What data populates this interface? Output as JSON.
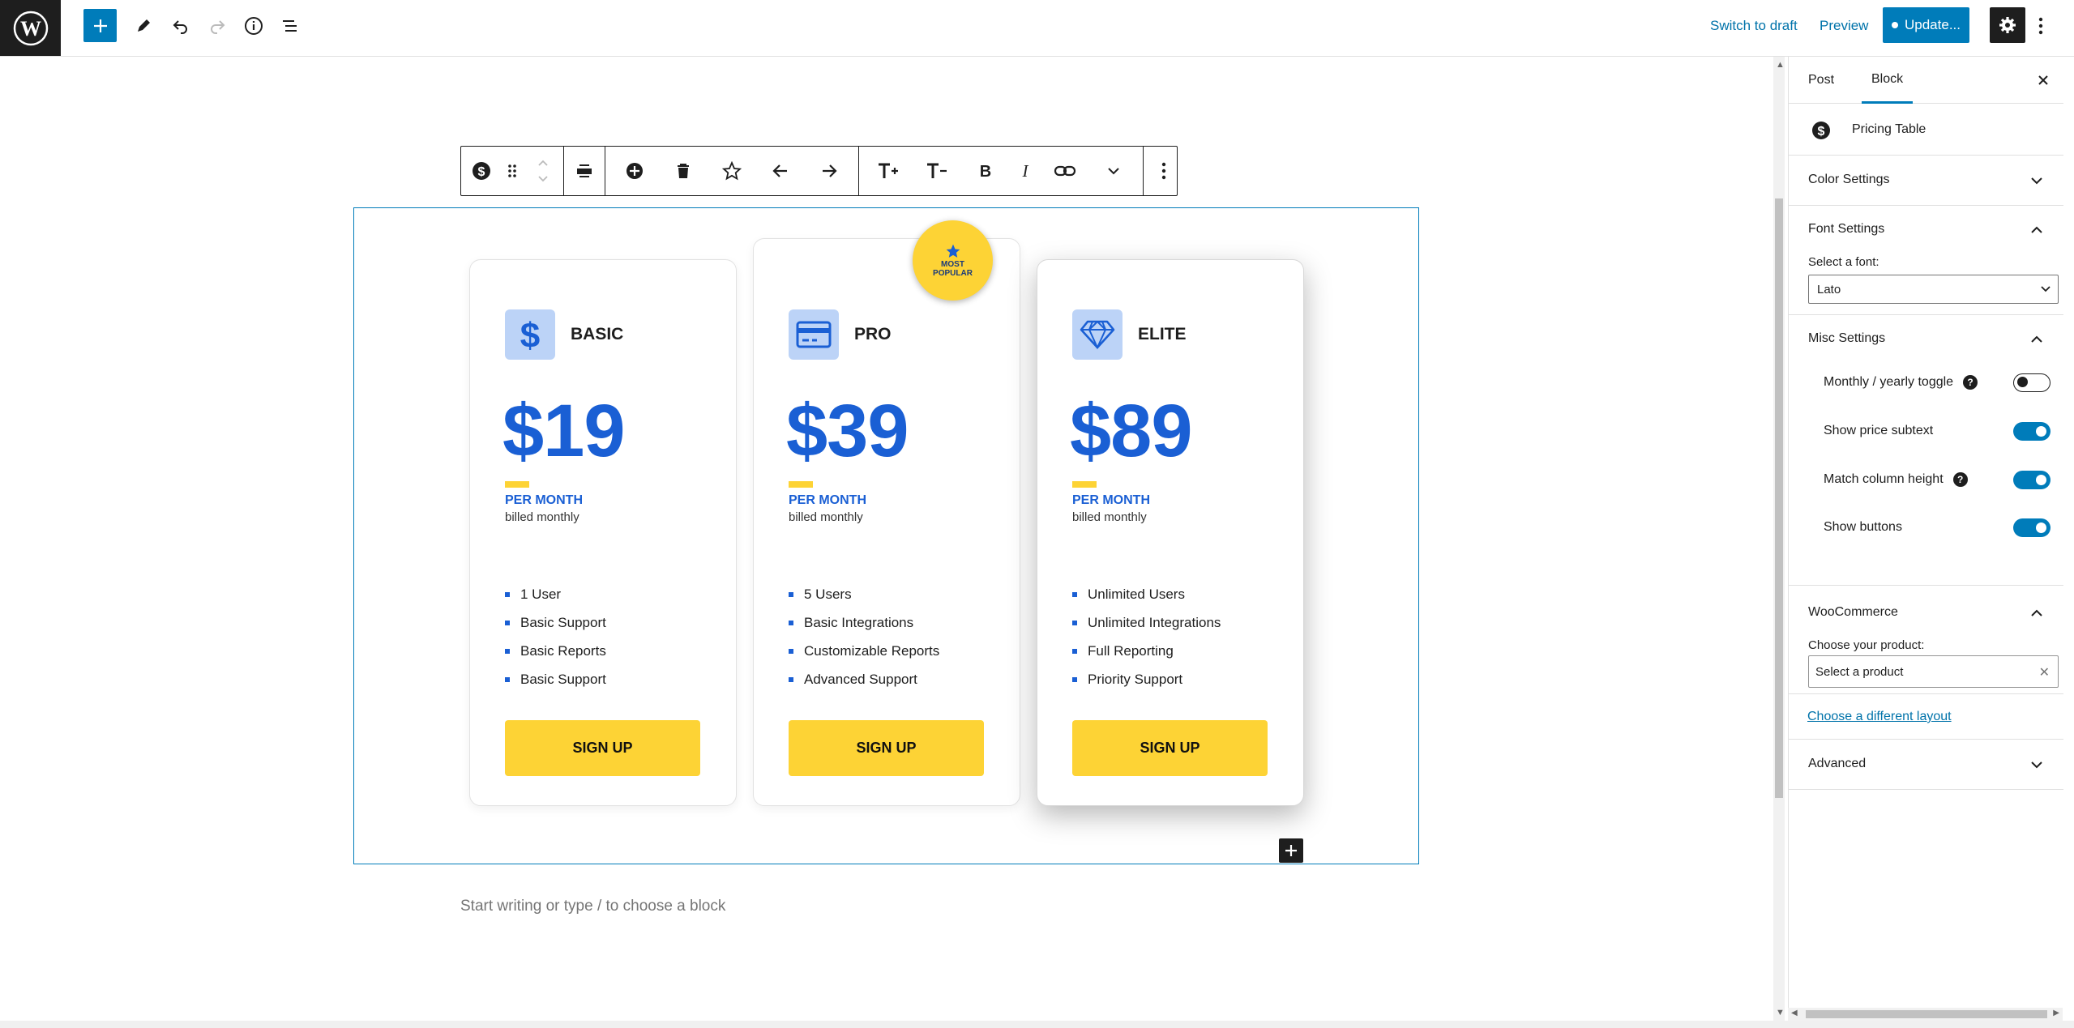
{
  "topbar": {
    "switch_to_draft": "Switch to draft",
    "preview": "Preview",
    "update": "Update..."
  },
  "icons": {
    "logo": "wordpress-logo",
    "add": "plus-icon",
    "edit": "pencil-icon",
    "undo": "undo-icon",
    "redo": "redo-icon",
    "details": "info-icon",
    "outline": "list-view-icon",
    "settings": "gear-icon",
    "more": "kebab-icon"
  },
  "pricing": {
    "badge": "MOST POPULAR",
    "cards": [
      {
        "name": "BASIC",
        "icon": "dollar-icon",
        "price": "$19",
        "period": "PER MONTH",
        "billing": "billed monthly",
        "features": [
          "1 User",
          "Basic Support",
          "Basic Reports",
          "Basic Support"
        ],
        "button": "SIGN UP"
      },
      {
        "name": "PRO",
        "icon": "credit-card-icon",
        "price": "$39",
        "period": "PER MONTH",
        "billing": "billed monthly",
        "features": [
          "5 Users",
          "Basic Integrations",
          "Customizable Reports",
          "Advanced Support"
        ],
        "button": "SIGN UP"
      },
      {
        "name": "ELITE",
        "icon": "diamond-icon",
        "price": "$89",
        "period": "PER MONTH",
        "billing": "billed monthly",
        "features": [
          "Unlimited Users",
          "Unlimited Integrations",
          "Full Reporting",
          "Priority Support"
        ],
        "button": "SIGN UP"
      }
    ]
  },
  "editor": {
    "placeholder": "Start writing or type / to choose a block"
  },
  "sidebar": {
    "tabs": [
      "Post",
      "Block"
    ],
    "block_name": "Pricing Table",
    "color_settings": "Color Settings",
    "font_settings": "Font Settings",
    "font_label": "Select a font:",
    "font_value": "Lato",
    "misc_settings": "Misc Settings",
    "toggles": [
      {
        "label": "Monthly / yearly toggle",
        "on": false,
        "help": true
      },
      {
        "label": "Show price subtext",
        "on": true,
        "help": false
      },
      {
        "label": "Match column height",
        "on": true,
        "help": true
      },
      {
        "label": "Show buttons",
        "on": true,
        "help": false
      }
    ],
    "woocommerce": "WooCommerce",
    "product_label": "Choose your product:",
    "product_placeholder": "Select a product",
    "layout_link": "Choose a different layout",
    "advanced": "Advanced"
  },
  "colors": {
    "accent": "#007cba",
    "price_blue": "#1a5fd4",
    "button_yellow": "#fdd335",
    "icon_bg": "#bcd3f7"
  }
}
